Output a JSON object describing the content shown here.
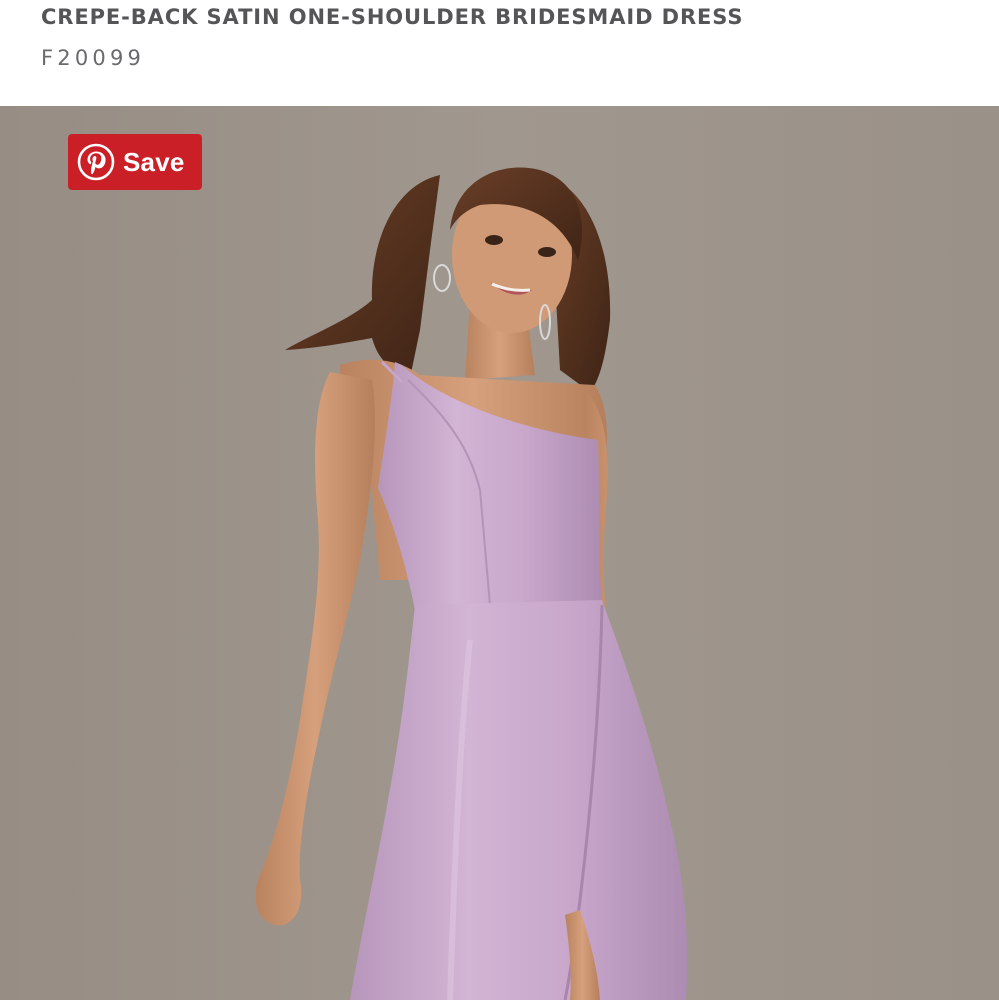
{
  "product": {
    "title": "CREPE-BACK SATIN ONE-SHOULDER BRIDESMAID DRESS",
    "sku": "F20099"
  },
  "pinterest": {
    "save_label": "Save",
    "icon": "pinterest-icon",
    "color": "#cb1f27"
  },
  "photo": {
    "background_color": "#9d948b",
    "dress_color": "#c9a9cc"
  }
}
